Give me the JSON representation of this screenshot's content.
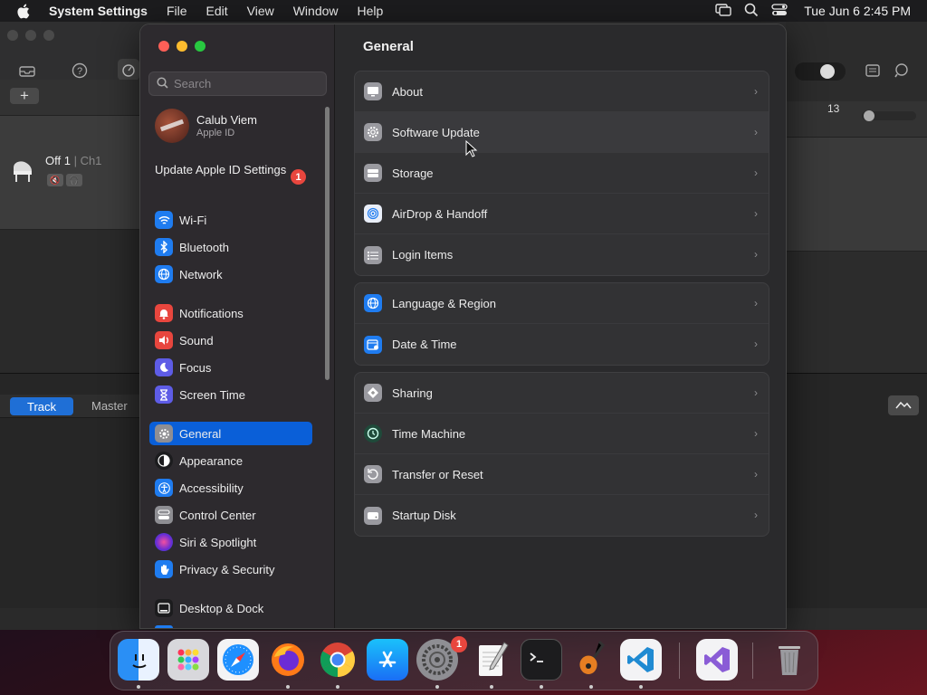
{
  "menubar": {
    "app": "System Settings",
    "items": [
      "File",
      "Edit",
      "View",
      "Window",
      "Help"
    ],
    "clock": "Tue Jun 6  2:45 PM"
  },
  "background_app": {
    "track_name": "Off 1",
    "track_channel": "| Ch1",
    "tab_track": "Track",
    "tab_master": "Master",
    "ruler_number": "13",
    "add_label": "+"
  },
  "sidebar": {
    "search_placeholder": "Search",
    "account_name": "Calub Viem",
    "account_sub": "Apple ID",
    "update_label": "Update Apple ID Settings",
    "update_badge": "1",
    "items": [
      {
        "label": "Wi-Fi",
        "color": "#1f7cf0"
      },
      {
        "label": "Bluetooth",
        "color": "#1f7cf0"
      },
      {
        "label": "Network",
        "color": "#1f7cf0"
      },
      {
        "label": "Notifications",
        "color": "#e8463e"
      },
      {
        "label": "Sound",
        "color": "#e8463e"
      },
      {
        "label": "Focus",
        "color": "#5e5ce6"
      },
      {
        "label": "Screen Time",
        "color": "#5e5ce6"
      },
      {
        "label": "General",
        "color": "#8e8e93"
      },
      {
        "label": "Appearance",
        "color": "#1c1c1e"
      },
      {
        "label": "Accessibility",
        "color": "#1f7cf0"
      },
      {
        "label": "Control Center",
        "color": "#8e8e93"
      },
      {
        "label": "Siri & Spotlight",
        "color": "#b03ad0"
      },
      {
        "label": "Privacy & Security",
        "color": "#1f7cf0"
      },
      {
        "label": "Desktop & Dock",
        "color": "#1c1c1e"
      }
    ],
    "selected": "General"
  },
  "main": {
    "title": "General",
    "groups": [
      [
        "About",
        "Software Update",
        "Storage",
        "AirDrop & Handoff",
        "Login Items"
      ],
      [
        "Language & Region",
        "Date & Time"
      ],
      [
        "Sharing",
        "Time Machine",
        "Transfer or Reset",
        "Startup Disk"
      ]
    ]
  },
  "dock": {
    "settings_badge": "1"
  }
}
